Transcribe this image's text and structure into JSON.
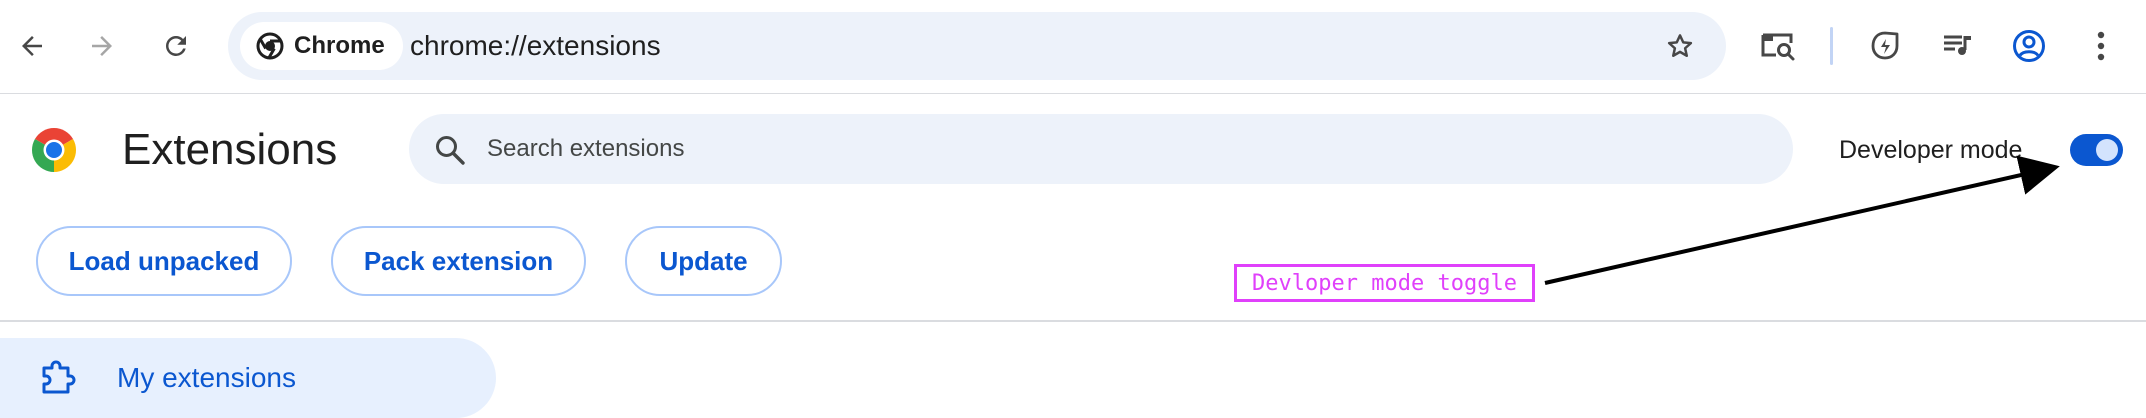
{
  "browser": {
    "site_chip_label": "Chrome",
    "url": "chrome://extensions"
  },
  "toolbar_icons": [
    "back-arrow-icon",
    "forward-arrow-icon",
    "reload-icon",
    "star-icon",
    "tab-search-icon",
    "energy-saver-icon",
    "media-playlist-icon",
    "profile-icon",
    "kebab-menu-icon"
  ],
  "header": {
    "title": "Extensions",
    "search_placeholder": "Search extensions",
    "developer_mode_label": "Developer mode",
    "developer_mode_on": true
  },
  "actions": {
    "load_unpacked": "Load unpacked",
    "pack_extension": "Pack extension",
    "update": "Update"
  },
  "sidebar": {
    "items": [
      {
        "label": "My extensions",
        "icon": "puzzle-icon",
        "selected": true
      }
    ]
  },
  "annotation": {
    "label": "Devloper mode toggle",
    "color": "#e040fb"
  },
  "colors": {
    "accent": "#0b57d0",
    "omnibox_bg": "#edf2fa",
    "selected_bg": "#d3e3fd"
  }
}
